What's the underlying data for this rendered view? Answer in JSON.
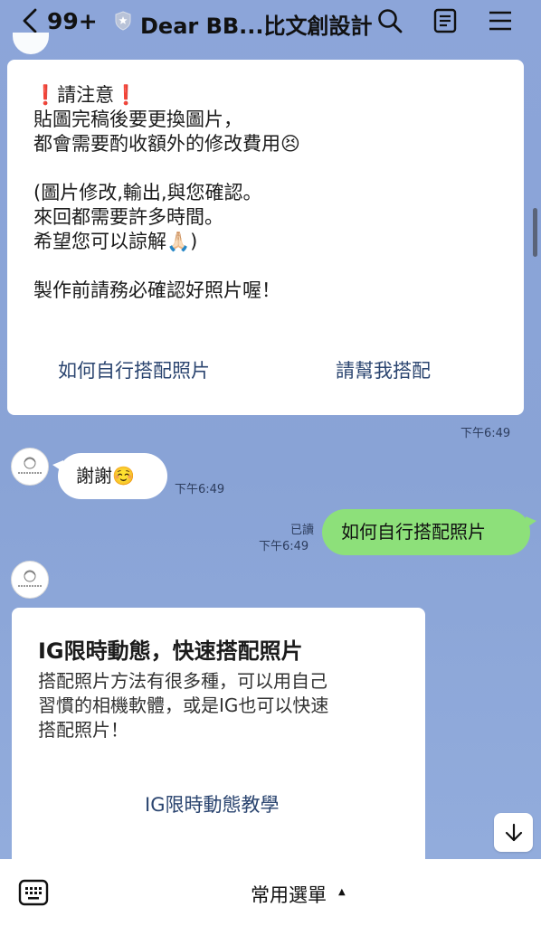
{
  "header": {
    "unread_count": "99+",
    "title": "Dear BB...比文創設計"
  },
  "card1": {
    "lines": [
      "❗️請注意❗️",
      "貼圖完稿後要更換圖片，",
      "都會需要酌收額外的修改費用😣",
      "",
      "(圖片修改,輸出,與您確認。",
      "來回都需要許多時間。",
      "希望您可以諒解🙏🏻)",
      "",
      "製作前請務必確認好照片喔！"
    ],
    "action_left": "如何自行搭配照片",
    "action_right": "請幫我搭配",
    "time": "下午6:49"
  },
  "msg_thanks": {
    "text": "謝謝☺️",
    "time": "下午6:49"
  },
  "msg_sent": {
    "text": "如何自行搭配照片",
    "read_label": "已讀",
    "time": "下午6:49"
  },
  "card2": {
    "title": "IG限時動態，快速搭配照片",
    "desc_lines": [
      "搭配照片方法有很多種，可以用自己",
      "習慣的相機軟體，或是IG也可以快速",
      "搭配照片！"
    ],
    "action": "IG限時動態教學"
  },
  "bottom_bar": {
    "menu_label": "常用選單",
    "caret": "▲"
  },
  "colors": {
    "chat_background": "#8aa4d8",
    "sent_bubble": "#8de07a",
    "link_text": "#2b4570"
  },
  "icons": [
    "back-arrow-icon",
    "shield-icon",
    "search-icon",
    "note-icon",
    "hamburger-menu-icon",
    "keyboard-icon",
    "arrow-down-icon"
  ]
}
